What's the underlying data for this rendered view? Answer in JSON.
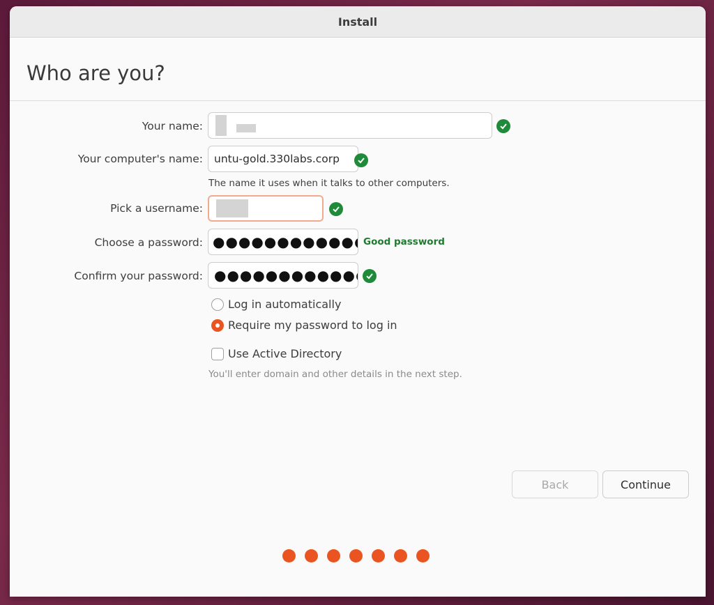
{
  "window": {
    "title": "Install"
  },
  "page": {
    "title": "Who are you?"
  },
  "form": {
    "name_label": "Your name:",
    "computer_label": "Your computer's name:",
    "computer_value": "untu-gold.330labs.corp",
    "computer_hint": "The name it uses when it talks to other computers.",
    "username_label": "Pick a username:",
    "password_label": "Choose a password:",
    "password_value": "●●●●●●●●●●●●",
    "password_strength": "Good password",
    "confirm_label": "Confirm your password:",
    "confirm_value": "●●●●●●●●●●●●●",
    "login_auto_label": "Log in automatically",
    "require_password_label": "Require my password to log in",
    "login_mode_selected": "require_password",
    "active_directory_label": "Use Active Directory",
    "active_directory_checked": false,
    "active_directory_hint": "You'll enter domain and other details in the next step."
  },
  "buttons": {
    "back": "Back",
    "continue": "Continue"
  },
  "progress": {
    "total_steps": 7
  },
  "colors": {
    "accent": "#e95420",
    "success": "#1f8a3a"
  },
  "icons": {
    "valid": "check-circle-icon",
    "reveal": "eye-icon"
  }
}
